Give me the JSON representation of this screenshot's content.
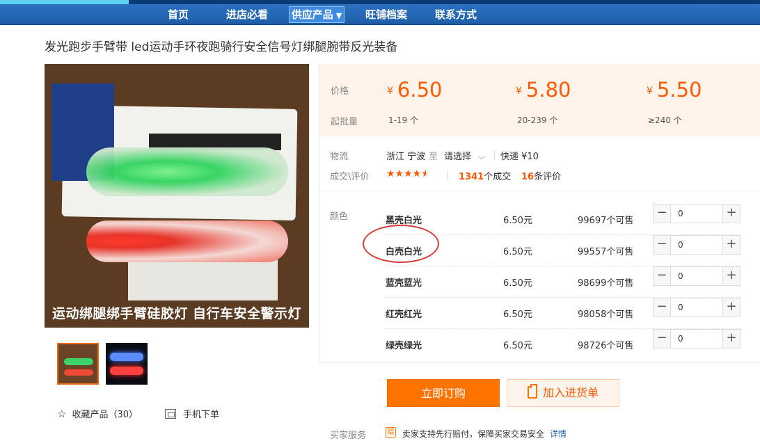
{
  "nav": {
    "items": [
      {
        "label": "首页"
      },
      {
        "label": "进店必看"
      },
      {
        "label": "供应产品",
        "active": true,
        "caret": "▼"
      },
      {
        "label": "旺铺档案"
      },
      {
        "label": "联系方式"
      }
    ]
  },
  "product": {
    "title": "发光跑步手臂带 led运动手环夜跑骑行安全信号灯绑腿腕带反光装备",
    "image_caption": "运动绑腿绑手臂硅胶灯  自行车安全警示灯",
    "collect_label": "收藏产品（30）",
    "mobile_label": "手机下单"
  },
  "pricing": {
    "price_label": "价格",
    "moq_label": "起批量",
    "currency": "¥",
    "tiers": [
      {
        "price": "6.50",
        "qty": "1-19 个"
      },
      {
        "price": "5.80",
        "qty": "20-239 个"
      },
      {
        "price": "5.50",
        "qty": "≥240 个"
      }
    ]
  },
  "logistics": {
    "label": "物流",
    "origin": "浙江 宁波",
    "to": "至",
    "select": "请选择",
    "express": "快递 ¥10"
  },
  "deals": {
    "label": "成交\\评价",
    "rating": 4.5,
    "deal_count": "1341",
    "deal_suffix": "个成交",
    "review_count": "16",
    "review_suffix": "条评价"
  },
  "variants": {
    "label": "颜色",
    "rows": [
      {
        "name": "黑壳白光",
        "price": "6.50元",
        "stock": "99697个可售",
        "qty": "0"
      },
      {
        "name": "白壳白光",
        "price": "6.50元",
        "stock": "99557个可售",
        "qty": "0"
      },
      {
        "name": "蓝壳蓝光",
        "price": "6.50元",
        "stock": "98699个可售",
        "qty": "0"
      },
      {
        "name": "红壳红光",
        "price": "6.50元",
        "stock": "98058个可售",
        "qty": "0"
      },
      {
        "name": "绿壳绿光",
        "price": "6.50元",
        "stock": "98726个可售",
        "qty": "0"
      }
    ]
  },
  "actions": {
    "buy_now": "立即订购",
    "add_to_list": "加入进货单"
  },
  "service": {
    "label": "买家服务",
    "icon_text": "赔",
    "text": "卖家支持先行赔付，保障买家交易安全",
    "link": "详情"
  },
  "colors": {
    "nav_blue": "#1f5fa9",
    "accent_orange": "#ff5a00",
    "price_bg": "#fff3ea"
  }
}
